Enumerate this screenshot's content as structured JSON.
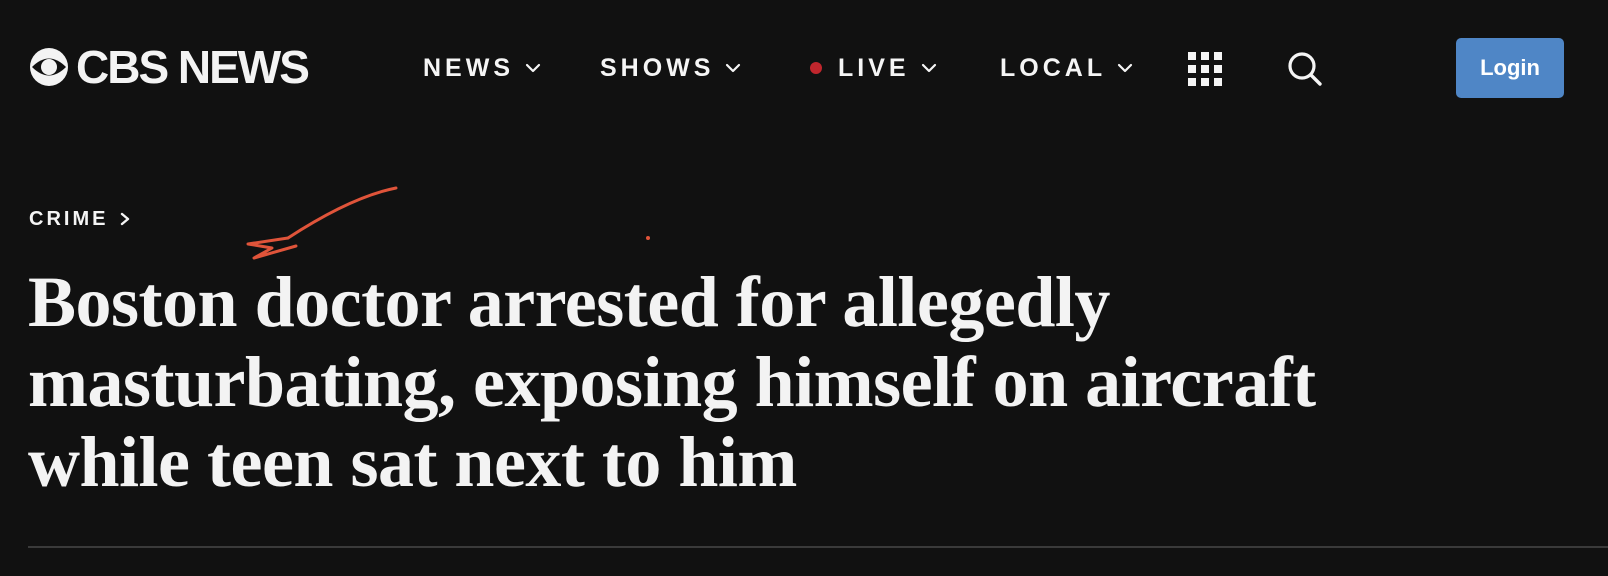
{
  "header": {
    "logo_text": "CBS NEWS",
    "nav": [
      {
        "label": "NEWS"
      },
      {
        "label": "SHOWS"
      },
      {
        "label": "LIVE"
      },
      {
        "label": "LOCAL"
      }
    ],
    "login_label": "Login"
  },
  "article": {
    "category": "CRIME",
    "headline_lines": [
      "Boston doctor arrested for allegedly",
      "masturbating, exposing himself on aircraft",
      "while teen sat next to him"
    ]
  },
  "colors": {
    "background": "#111111",
    "text": "#f5f5f5",
    "live_dot": "#c0262d",
    "login_button": "#4f86c6",
    "annotation": "#e0543a",
    "divider": "#3a3a3a"
  },
  "icons": {
    "logo": "cbs-eye-icon",
    "nav_dropdown": "chevron-down-icon",
    "live": "live-dot-icon",
    "apps": "grid-icon",
    "search": "search-icon",
    "breadcrumb": "chevron-right-icon"
  }
}
